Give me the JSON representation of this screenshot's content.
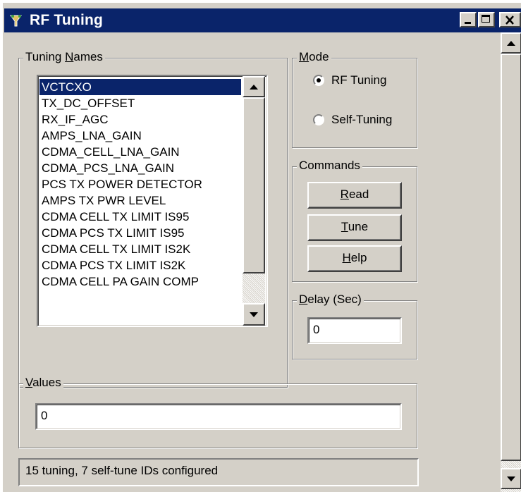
{
  "window": {
    "title": "RF Tuning",
    "minimize_label": "_",
    "maximize_label": "☐",
    "close_label": "✕"
  },
  "tuning_names": {
    "label_pre": "Tuning ",
    "label_accel": "N",
    "label_post": "ames",
    "items": [
      "VCTCXO",
      "TX_DC_OFFSET",
      "RX_IF_AGC",
      "AMPS_LNA_GAIN",
      "CDMA_CELL_LNA_GAIN",
      "CDMA_PCS_LNA_GAIN",
      "PCS TX POWER DETECTOR",
      "AMPS TX PWR LEVEL",
      "CDMA CELL TX LIMIT IS95",
      "CDMA PCS TX LIMIT IS95",
      "CDMA CELL TX LIMIT IS2K",
      "CDMA PCS TX LIMIT IS2K",
      "CDMA CELL PA GAIN COMP"
    ],
    "selected_index": 0
  },
  "mode": {
    "label_accel": "M",
    "label_post": "ode",
    "options": [
      {
        "label": "RF Tuning",
        "checked": true
      },
      {
        "label": "Self-Tuning",
        "checked": false
      }
    ]
  },
  "commands": {
    "label": "Commands",
    "read_accel": "R",
    "read_post": "ead",
    "tune_accel": "T",
    "tune_post": "une",
    "help_accel": "H",
    "help_post": "elp"
  },
  "delay": {
    "label_accel": "D",
    "label_post": "elay (Sec)",
    "value": "0"
  },
  "values": {
    "label_accel": "V",
    "label_post": "alues",
    "value": "0"
  },
  "status": {
    "text": "15 tuning, 7 self-tune IDs configured"
  },
  "colors": {
    "titlebar": "#0a246a",
    "selection": "#0a246a",
    "face": "#d4d0c8"
  }
}
